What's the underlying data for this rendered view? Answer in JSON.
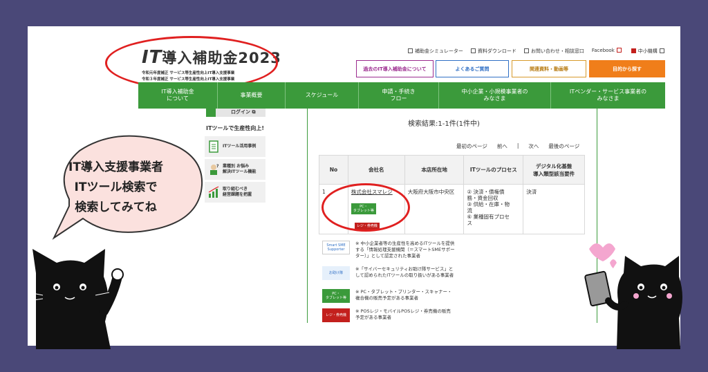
{
  "logo": {
    "it": "IT",
    "title": "導入補助金2023",
    "sub1": "令和元年度補正 サービス等生産性向上IT導入支援事業",
    "sub2": "令和３年度補正 サービス等生産性向上IT導入支援事業"
  },
  "utility_links": [
    {
      "label": "補助金シミュレーター"
    },
    {
      "label": "資料ダウンロード"
    },
    {
      "label": "お問い合わせ・相談窓口"
    },
    {
      "label": "Facebook"
    },
    {
      "label": "中小機構"
    }
  ],
  "header_buttons": {
    "past": "過去のIT導入補助金について",
    "faq": "よくあるご質問",
    "docs": "関連資料・動画等",
    "purpose": "目的から探す"
  },
  "nav": [
    "IT導入補助金\nについて",
    "事業概要",
    "スケジュール",
    "申請・手続き\nフロー",
    "中小企業・小規模事業者の\nみなさま",
    "ITベンダー・サービス事業者の\nみなさま"
  ],
  "sidebar": {
    "login": "ログイン",
    "section_title": "ITツールで生産性向上!",
    "items": [
      "ITツール活用事例",
      "業種別 お悩み\n解決ITツール機能",
      "取り組むべき\n経営課題を把握"
    ]
  },
  "results": {
    "title": "検索結果:1-1件(1件中)",
    "pager": {
      "first": "最初のページ",
      "prev": "前へ",
      "sep": "|",
      "next": "次へ",
      "last": "最後のページ"
    },
    "headers": [
      "No",
      "会社名",
      "本店所在地",
      "ITツールのプロセス",
      "デジタル化基盤\n導入類型該当要件"
    ],
    "row": {
      "no": "1",
      "company": "株式会社スマレジ",
      "tag_pc": "PC・\nタブレット等",
      "tag_reg": "レジ・券売機",
      "address": "大阪府大阪市中央区",
      "process": "② 決済・債権債\n務・資金回収\n③ 供給・在庫・物\n流\n⑥ 業種固有プロセ\nス",
      "requirement": "決済"
    }
  },
  "legend": [
    {
      "badge": "Smart SME Supporter",
      "text": "※ 中小企業者等の生産性を高めるITツールを提供\nする「情報処理支援機関（＝スマートSMEサポー\nター）」として認定された事業者"
    },
    {
      "badge": "お助け隊",
      "text": "※「サイバーセキュリティお助け隊サービス」と\nして認められたITツールの取り扱いがある事業者"
    },
    {
      "badge": "PC・\nタブレット等",
      "text": "※ PC・タブレット・プリンター・スキャナー・\n複合機の販売予定がある事業者"
    },
    {
      "badge": "レジ・券売機",
      "text": "※ POSレジ・モバイルPOSレジ・券売機の販売\n予定がある事業者"
    }
  ],
  "bubble": {
    "text": "IT導入支援事業者\nITツール検索で\n検索してみてね"
  },
  "colors": {
    "frame": "#4a4878",
    "nav_green": "#3b9a3b",
    "highlight_red": "#e02020",
    "bubble_pink": "#fbe1de",
    "accent_orange": "#f07e1a"
  }
}
